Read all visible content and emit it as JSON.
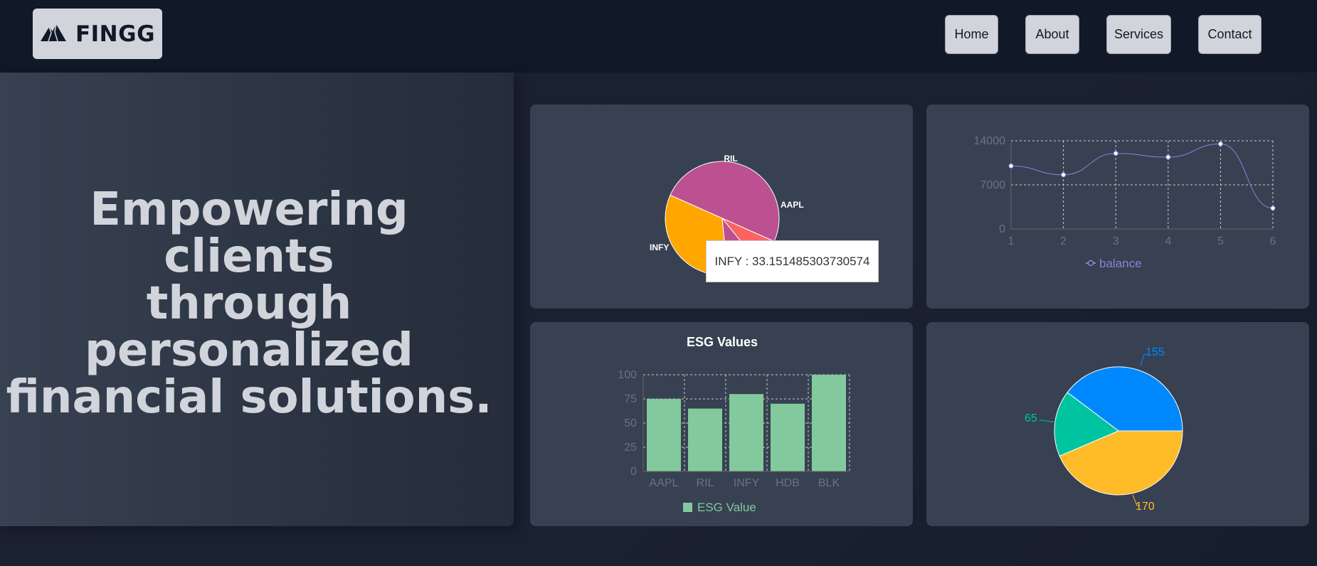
{
  "brand": {
    "name": "FINGG",
    "logo_icon": "mountain-icon"
  },
  "nav": {
    "items": [
      "Home",
      "About",
      "Services",
      "Contact"
    ]
  },
  "hero": {
    "headline_lines": [
      "Empowering clients",
      "through",
      "personalized",
      "financial solutions."
    ]
  },
  "tooltip": {
    "text": "INFY : 33.151485303730574"
  },
  "colors": {
    "ril": "#bc5090",
    "aapl": "#ff6361",
    "infy": "#ffa600",
    "line": "#8884d8",
    "bar": "#82ca9d",
    "blue": "#0088fe",
    "green": "#00c49f",
    "yellow": "#ffbb28"
  },
  "chart_data": [
    {
      "type": "pie",
      "labels": [
        "RIL",
        "AAPL",
        "INFY"
      ],
      "values": [
        50.0,
        7.5,
        33.151485303730574
      ],
      "unlabeled_slice": 9.35
    },
    {
      "type": "line",
      "x": [
        1,
        2,
        3,
        4,
        5,
        6
      ],
      "series": [
        {
          "name": "balance",
          "values": [
            10000,
            8600,
            12000,
            11400,
            13500,
            3300
          ]
        }
      ],
      "yticks": [
        0,
        7000,
        14000
      ],
      "ylim": [
        0,
        14000
      ],
      "grid": true,
      "legend": "bottom"
    },
    {
      "type": "bar",
      "title": "ESG Values",
      "categories": [
        "AAPL",
        "RIL",
        "INFY",
        "HDB",
        "BLK"
      ],
      "series": [
        {
          "name": "ESG Value",
          "values": [
            75,
            65,
            80,
            70,
            100
          ]
        }
      ],
      "yticks": [
        0,
        25,
        50,
        75,
        100
      ],
      "ylim": [
        0,
        100
      ],
      "grid": true,
      "legend": "bottom"
    },
    {
      "type": "pie",
      "values": [
        155,
        170,
        65
      ],
      "labels": [
        "155",
        "170",
        "65"
      ]
    }
  ]
}
